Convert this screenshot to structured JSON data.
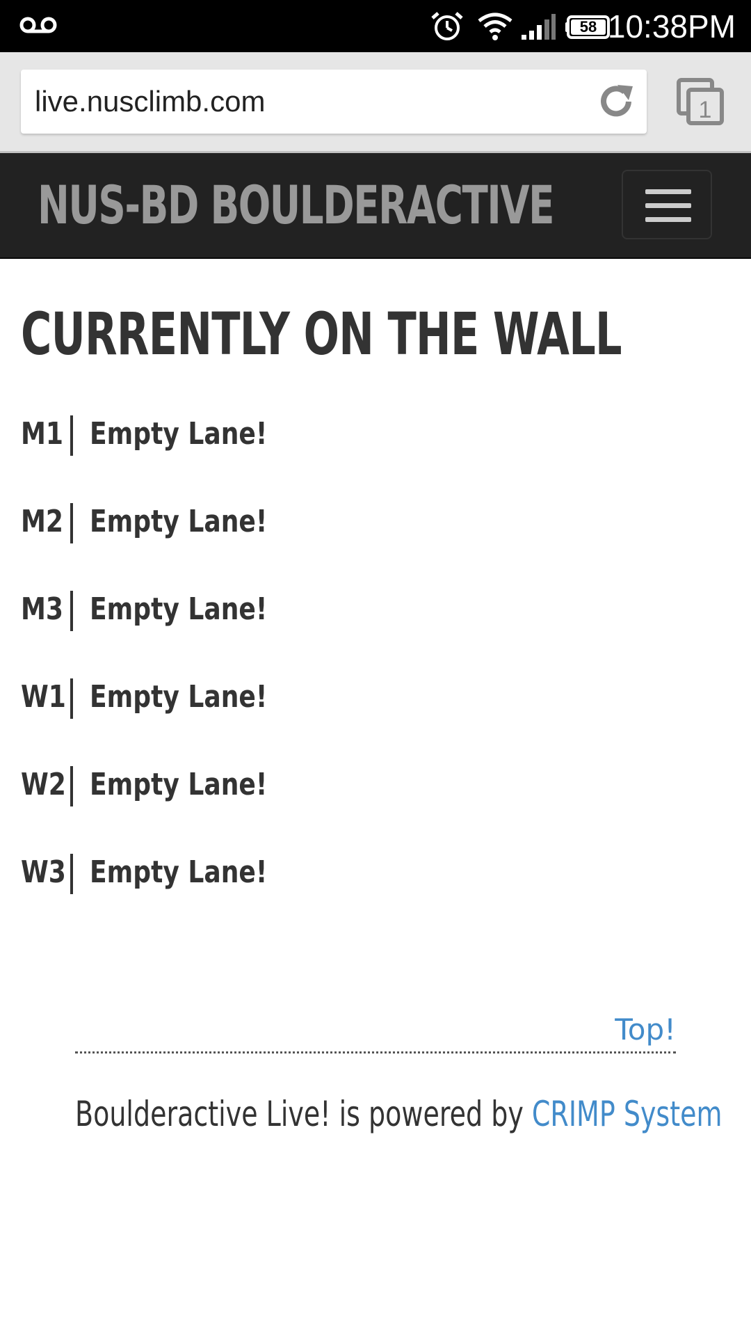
{
  "status_bar": {
    "time": "10:38PM",
    "battery_level": "58",
    "icons": [
      "voicemail-icon",
      "alarm-icon",
      "wifi-icon",
      "signal-icon",
      "battery-icon"
    ]
  },
  "browser": {
    "url": "live.nusclimb.com",
    "tab_count": "1",
    "icons": [
      "reload-icon",
      "tabs-icon"
    ]
  },
  "navbar": {
    "brand": "NUS-BD BOULDERACTIVE",
    "menu_icon": "hamburger-menu-icon"
  },
  "main": {
    "title": "CURRENTLY ON THE WALL",
    "lanes": [
      {
        "code": "M1",
        "status": "Empty Lane!"
      },
      {
        "code": "M2",
        "status": "Empty Lane!"
      },
      {
        "code": "M3",
        "status": "Empty Lane!"
      },
      {
        "code": "W1",
        "status": "Empty Lane!"
      },
      {
        "code": "W2",
        "status": "Empty Lane!"
      },
      {
        "code": "W3",
        "status": "Empty Lane!"
      }
    ]
  },
  "footer": {
    "top_link": "Top!",
    "powered_by_text": "Boulderactive Live! is powered by ",
    "powered_by_link": "CRIMP System"
  },
  "colors": {
    "status_bar_bg": "#000000",
    "browser_bar_bg": "#e6e6e6",
    "navbar_bg": "#222222",
    "brand_text": "#999999",
    "body_text": "#333333",
    "link": "#428bca"
  }
}
